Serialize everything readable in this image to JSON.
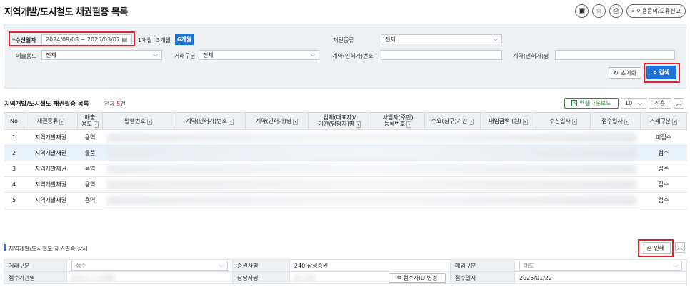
{
  "page": {
    "title": "지역개발/도시철도 채권필증 목록"
  },
  "top": {
    "bookmark": "bookmark-icon",
    "star": "star-icon",
    "print": "printer-icon",
    "inquiry": "이용문의/오류신고"
  },
  "search": {
    "date_label": "*수신일자",
    "date_from": "2024/09/08",
    "date_sep": "~",
    "date_to": "2025/03/07",
    "periods": [
      "1개월",
      "3개월",
      "6개월"
    ],
    "bond_type_label": "채권종류",
    "bond_type_value": "전체",
    "sales_use_label": "매출용도",
    "sales_use_value": "전체",
    "trade_type_label": "거래구분",
    "trade_type_value": "전체",
    "contract_no_label": "계약(인허가)번호",
    "contract_no_value": "",
    "contract_name_label": "계약(인허가)명",
    "contract_name_value": "",
    "reset": "초기화",
    "submit": "검색"
  },
  "list": {
    "title": "지역개발/도시철도 채권필증 목록",
    "total_prefix": "전체",
    "total_count": "5",
    "total_suffix": "건",
    "excel": "엑셀다운로드",
    "page_size": "10",
    "apply": "적용",
    "columns": [
      "No",
      "채권종류",
      "매출\n용도",
      "발행번호",
      "계약(인허가)번호",
      "계약(인허가)명",
      "업체(대표자)/\n기관(담당자)명",
      "사업자(주민)\n등록번호",
      "수요(징구)기관",
      "매입금액 (원)",
      "수신일자",
      "접수일자",
      "거래구분"
    ],
    "rows": [
      {
        "no": "1",
        "type": "지역개발채권",
        "use": "용역",
        "status": "미접수"
      },
      {
        "no": "2",
        "type": "지역개발채권",
        "use": "물품",
        "status": "접수"
      },
      {
        "no": "3",
        "type": "지역개발채권",
        "use": "용역",
        "status": "접수"
      },
      {
        "no": "4",
        "type": "지역개발채권",
        "use": "용역",
        "status": "접수"
      },
      {
        "no": "5",
        "type": "지역개발채권",
        "use": "용역",
        "status": "접수"
      }
    ]
  },
  "detail": {
    "title": "지역개발/도시철도 채권필증 상세",
    "print": "인쇄",
    "trade_label": "거래구분",
    "trade_value": "접수",
    "broker_label": "증권사명",
    "broker_value": "240 삼성증권",
    "buy_label": "매입구분",
    "buy_value": "매도",
    "agency_label": "접수기관명",
    "manager_label": "담당자명",
    "change_id": "접수자ID 변경",
    "recv_date_label": "접수일자",
    "recv_date_value": "2025/01/22"
  }
}
